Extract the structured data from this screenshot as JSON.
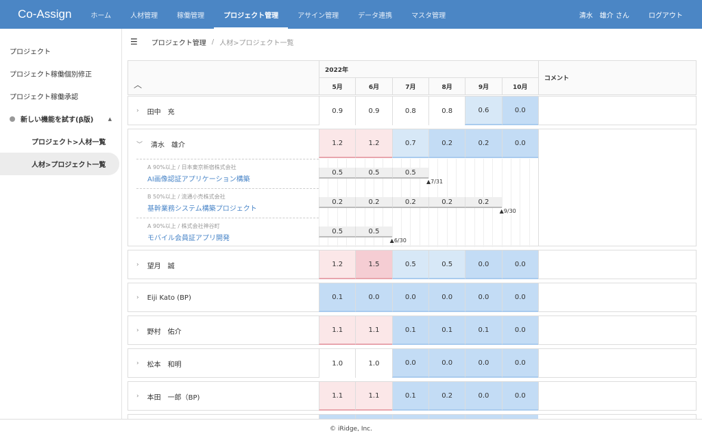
{
  "app": {
    "title": "Co-Assign",
    "nav": [
      "ホーム",
      "人材管理",
      "稼働管理",
      "プロジェクト管理",
      "アサイン管理",
      "データ連携",
      "マスタ管理"
    ],
    "active_nav": 3,
    "user": "清水　雄介 さん",
    "logout": "ログアウト"
  },
  "sidebar": {
    "items": [
      "プロジェクト",
      "プロジェクト稼働個別修正",
      "プロジェクト稼働承認"
    ],
    "group": "新しい機能を試す(β版)",
    "sub": [
      "プロジェクト>人材一覧",
      "人材>プロジェクト一覧"
    ],
    "active_sub": 1
  },
  "breadcrumb": {
    "current": "プロジェクト管理",
    "separator": "/",
    "page": "人材>プロジェクト一覧"
  },
  "table": {
    "year": "2022年",
    "months": [
      "5月",
      "6月",
      "7月",
      "8月",
      "9月",
      "10月"
    ],
    "comment": "コメント",
    "rows": [
      {
        "name": "田中　充",
        "values": [
          0.9,
          0.9,
          0.8,
          0.8,
          0.6,
          0.0
        ],
        "expanded": false
      },
      {
        "name": "清水　雄介",
        "values": [
          1.2,
          1.2,
          0.7,
          0.2,
          0.2,
          0.0
        ],
        "expanded": true,
        "projects": [
          {
            "meta": "A 90%以上 / 日本東京新宿株式会社",
            "title": "AI画像認証アプリケーション構築",
            "values": [
              0.5,
              0.5,
              0.5
            ],
            "deadline": "7/31"
          },
          {
            "meta": "B 50%以上 / 流通小売株式会社",
            "title": "基幹業務システム構築プロジェクト",
            "values": [
              0.2,
              0.2,
              0.2,
              0.2,
              0.2
            ],
            "deadline": "9/30"
          },
          {
            "meta": "A 90%以上 / 株式会社神谷町",
            "title": "モバイル会員証アプリ開発",
            "values": [
              0.5,
              0.5
            ],
            "deadline": "6/30"
          }
        ]
      },
      {
        "name": "望月　誠",
        "values": [
          1.2,
          1.5,
          0.5,
          0.5,
          0.0,
          0.0
        ],
        "expanded": false
      },
      {
        "name": "Eiji Kato (BP)",
        "values": [
          0.1,
          0.0,
          0.0,
          0.0,
          0.0,
          0.0
        ],
        "expanded": false
      },
      {
        "name": "野村　佑介",
        "values": [
          1.1,
          1.1,
          0.1,
          0.1,
          0.1,
          0.0
        ],
        "expanded": false
      },
      {
        "name": "松本　和明",
        "values": [
          1.0,
          1.0,
          0.0,
          0.0,
          0.0,
          0.0
        ],
        "expanded": false
      },
      {
        "name": "本田　一郎（BP)",
        "values": [
          1.1,
          1.1,
          0.1,
          0.2,
          0.0,
          0.0
        ],
        "expanded": false
      }
    ]
  },
  "colors": {
    "header": "#4b86c5",
    "over": "#fbe7e8",
    "over_high": "#f5cdd3",
    "under": "#d7e8f7",
    "low": "#c3dcf5",
    "link": "#4a86c8"
  },
  "footer": "© iRidge, Inc."
}
